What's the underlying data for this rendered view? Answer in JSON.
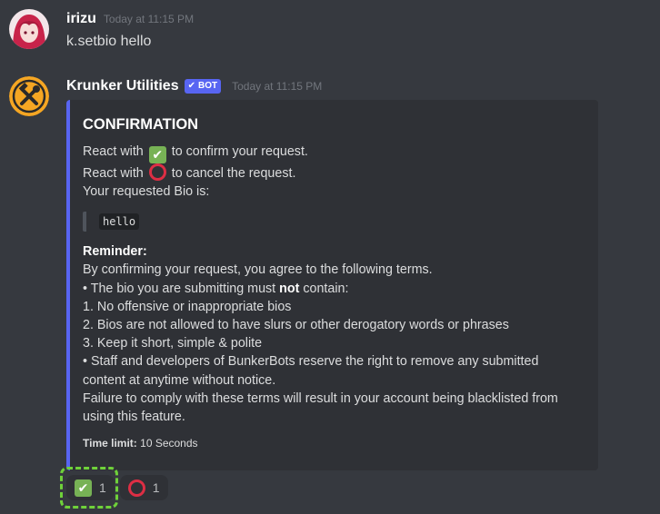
{
  "messages": [
    {
      "username": "irizu",
      "timestamp": "Today at 11:15 PM",
      "text": "k.setbio hello"
    },
    {
      "username": "Krunker Utilities",
      "bot_tag": "BOT",
      "timestamp": "Today at 11:15 PM",
      "embed": {
        "title": "CONFIRMATION",
        "react_confirm_pre": "React with",
        "react_confirm_post": "to confirm your request.",
        "react_cancel_pre": "React with",
        "react_cancel_post": "to cancel the request.",
        "requested_bio_label": "Your requested Bio is:",
        "bio_value": "hello",
        "reminder_title": "Reminder:",
        "terms_intro": "By confirming your request, you agree to the following terms.",
        "must_not_pre": "• The bio you are submitting must",
        "must_not_bold": "not",
        "must_not_post": "contain:",
        "rules": [
          "1. No offensive or inappropriate bios",
          "2. Bios are not allowed to have slurs or other derogatory words or phrases",
          "3. Keep it short, simple & polite"
        ],
        "staff_line_1": "• Staff and developers of BunkerBots reserve the right to remove any submitted",
        "staff_line_2": "content at anytime without notice.",
        "failure_line_1": "Failure to comply with these terms will result in your account being blacklisted from",
        "failure_line_2": "using this feature.",
        "time_limit_label": "Time limit:",
        "time_limit_value": "10 Seconds"
      }
    }
  ],
  "reactions": [
    {
      "emoji": "check-mark-icon",
      "count": "1"
    },
    {
      "emoji": "hollow-red-circle-icon",
      "count": "1"
    }
  ],
  "colors": {
    "background": "#36393f",
    "embed_bg": "#2f3136",
    "embed_accent": "#5865f2",
    "bot_tag": "#5865f2",
    "check": "#77b255",
    "circle": "#dd2e44",
    "highlight": "#6fd13a"
  }
}
